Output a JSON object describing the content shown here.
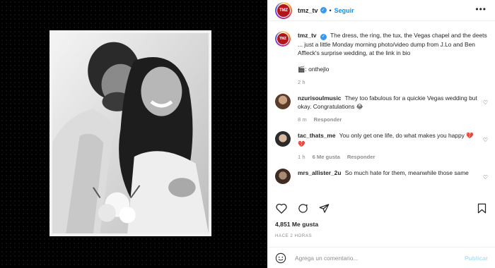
{
  "header": {
    "username": "tmz_tv",
    "follow_label": "Seguir",
    "separator": "•",
    "logo_text": "TMZ",
    "verified_mark": "✓"
  },
  "caption": {
    "username": "tmz_tv",
    "text": "The dress, the ring, the tux, the Vegas chapel and the deets ... just a little Monday morning photo/video dump from J.Lo and Ben Affleck's surprise wedding, at the link in bio",
    "hint": "🎬: onthejlo",
    "time": "2 h"
  },
  "comments": [
    {
      "username": "nzurisoulmusic",
      "text": "They too fabulous for a quickie Vegas wedding but okay. Congratulations 😂",
      "time": "8 m",
      "likes": "",
      "reply_label": "Responder"
    },
    {
      "username": "tac_thats_me",
      "text": "You only get one life, do what makes you happy 💔💔",
      "time": "1 h",
      "likes": "6 Me gusta",
      "reply_label": "Responder"
    },
    {
      "username": "mrs_allister_2u",
      "text": "So much hate for them, meanwhile those same",
      "time": "",
      "likes": "",
      "reply_label": ""
    }
  ],
  "stats": {
    "likes": "4,851 Me gusta",
    "time_ago": "HACE 2 HORAS"
  },
  "add_comment": {
    "placeholder": "Agrega un comentario...",
    "publish_label": "Publicar"
  },
  "colors": {
    "accent": "#0095f6",
    "brand_red": "#b3151b"
  }
}
